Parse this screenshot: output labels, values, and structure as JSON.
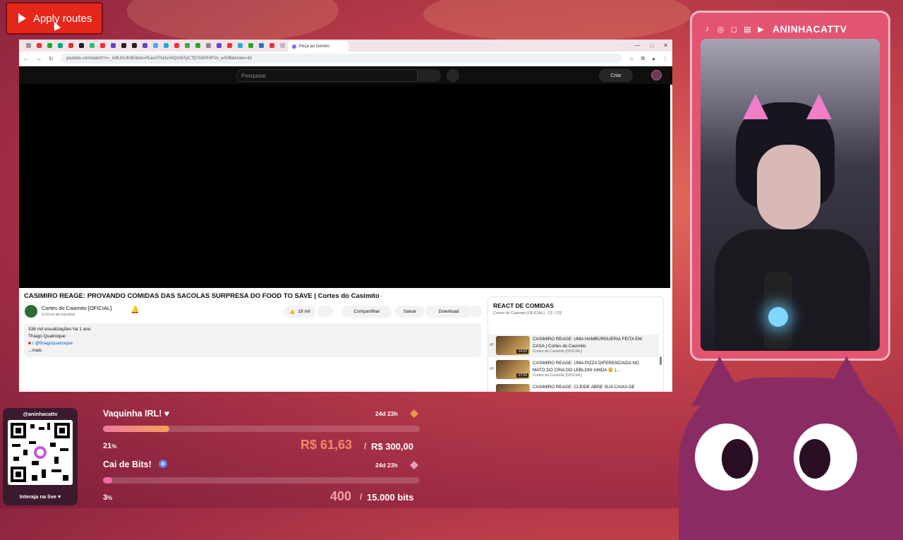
{
  "overlay": {
    "apply_routes_label": "Apply routes",
    "streamer_handle": "ANINHACATTV",
    "qr_handle": "@aninhacattv",
    "qr_caption": "Interaja na live ♥"
  },
  "browser": {
    "active_tab_label": "Peça ao Gemini",
    "url": "youtube.com/watch?v=_m9UtXJKttE&list=PLeuV7kOuAhQmNTyCTfj7A9rPHPUb_wS0B&index=42",
    "search_placeholder": "Pesquisar",
    "create_label": "Criar"
  },
  "video": {
    "title": "CASIMIRO REAGE: PROVANDO COMIDAS DAS SACOLAS SURPRESA DO FOOD TO SAVE | Cortes do Casimito",
    "channel_name": "Cortes do Casimito [OFICIAL]",
    "channel_subs": "4,03 mi de inscritos",
    "likes": "19 mil",
    "share_label": "Compartilhar",
    "save_label": "Salvar",
    "download_label": "Download",
    "views_line": "338 mil visualizações  há 1 ano",
    "desc_line1": "Thiago Quatroque:",
    "desc_line2": "/ @thiagoquatroque",
    "desc_more": "...mais"
  },
  "playlist": {
    "title": "REACT DE COMIDAS",
    "subtitle": "Cortes do Casimito [OFICIAL] - 21 / 722",
    "items": [
      {
        "index": "42",
        "title": "CASIMIRO REAGE: UMA HAMBURGUERIA FEITA EM CASA | Cortes do Casimito",
        "channel": "Cortes do Casimito [OFICIAL]",
        "duration": "14:53"
      },
      {
        "index": "43",
        "title": "CASIMIRO REAGE: UMA PIZZA DIFERENCIADA NO MATO DO CRIA DO LEBLON! AINDA 🤤 |...",
        "channel": "Cortes do Casimito [OFICIAL]",
        "duration": "17:04"
      },
      {
        "index": "",
        "title": "CASIMIRO REAGE: CLEIDE ABRE SUA CAIXA DE",
        "channel": "",
        "duration": ""
      }
    ]
  },
  "goals": {
    "g1": {
      "title": "Vaquinha IRL! ♥",
      "time": "24d 23h",
      "percent_label": "21",
      "percent_value": 21,
      "current": "R$ 61,63",
      "sep": "/",
      "target": "R$ 300,00"
    },
    "g2": {
      "title": "Cai de Bits!",
      "time": "24d 23h",
      "percent_label": "3",
      "percent_value": 3,
      "current": "400",
      "sep": "/",
      "target": "15.000 bits"
    }
  },
  "colors": {
    "accent_red": "#e5271b",
    "goal_amount": "#f08a6a",
    "frame_pink": "#e35471"
  }
}
